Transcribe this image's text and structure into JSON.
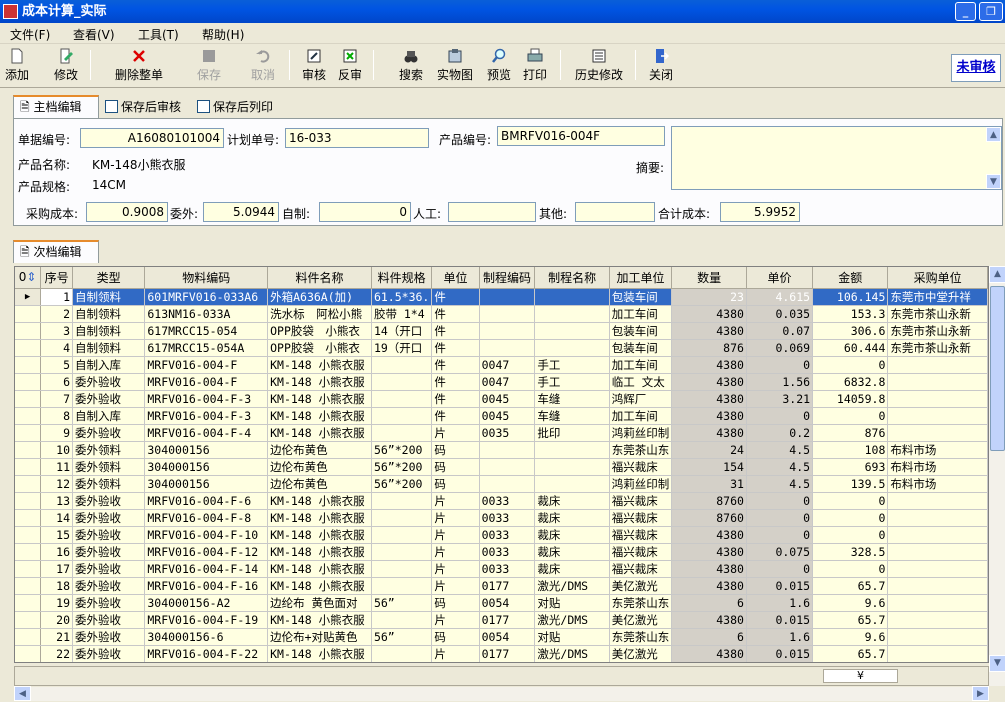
{
  "window": {
    "title": "成本计算_实际"
  },
  "menu": [
    "文件(F)",
    "查看(V)",
    "工具(T)",
    "帮助(H)"
  ],
  "toolbar": {
    "add": "添加",
    "edit": "修改",
    "delete_all": "删除整单",
    "save": "保存",
    "cancel": "取消",
    "review": "审核",
    "unreview": "反审",
    "search": "搜索",
    "photo": "实物图",
    "preview": "预览",
    "print": "打印",
    "history": "历史修改",
    "close": "关闭",
    "status": "未审核"
  },
  "main_tab": {
    "label": "主档编辑",
    "check_save_review": "保存后审核",
    "check_save_print": "保存后列印"
  },
  "form": {
    "doc_no_label": "单据编号:",
    "doc_no": "A16080101004",
    "plan_no_label": "计划单号:",
    "plan_no": "16-033",
    "product_no_label": "产品编号:",
    "product_no": "BMRFV016-004F",
    "product_name_label": "产品名称:",
    "product_name": "KM-148小熊衣服",
    "spec_label": "产品规格:",
    "spec": "14CM",
    "summary_label": "摘要:",
    "purchase_cost_label": "采购成本:",
    "purchase_cost": "0.9008",
    "outsource_label": "委外:",
    "outsource": "5.0944",
    "selfmade_label": "自制:",
    "selfmade": "0",
    "labor_label": "人工:",
    "labor": "",
    "other_label": "其他:",
    "other": "",
    "total_label": "合计成本:",
    "total": "5.9952"
  },
  "sub_tab": {
    "label": "次档编辑"
  },
  "grid": {
    "corner": "0",
    "headers": [
      "序号",
      "类型",
      "物料编码",
      "料件名称",
      "料件规格",
      "单位",
      "制程编码",
      "制程名称",
      "加工单位",
      "数量",
      "单价",
      "金额",
      "采购单位"
    ],
    "rows": [
      [
        "1",
        "自制领料",
        "601MRFV016-033A6",
        "外箱A636A(加)",
        "61.5*36.",
        "件",
        "",
        "",
        "包装车间",
        "23",
        "4.615",
        "106.145",
        "东莞市中堂升祥"
      ],
      [
        "2",
        "自制领料",
        "613NM16-033A",
        "洗水标　阿松小熊",
        "胶带 1*4",
        "件",
        "",
        "",
        "加工车间",
        "4380",
        "0.035",
        "153.3",
        "东莞市茶山永新"
      ],
      [
        "3",
        "自制领料",
        "617MRCC15-054",
        "OPP胶袋　小熊衣",
        "14（开口",
        "件",
        "",
        "",
        "包装车间",
        "4380",
        "0.07",
        "306.6",
        "东莞市茶山永新"
      ],
      [
        "4",
        "自制领料",
        "617MRCC15-054A",
        "OPP胶袋　小熊衣",
        "19（开口",
        "件",
        "",
        "",
        "包装车间",
        "876",
        "0.069",
        "60.444",
        "东莞市茶山永新"
      ],
      [
        "5",
        "自制入库",
        "MRFV016-004-F",
        "KM-148 小熊衣服",
        "",
        "件",
        "0047",
        "手工",
        "加工车间",
        "4380",
        "0",
        "0",
        ""
      ],
      [
        "6",
        "委外验收",
        "MRFV016-004-F",
        "KM-148 小熊衣服",
        "",
        "件",
        "0047",
        "手工",
        "临工 文太",
        "4380",
        "1.56",
        "6832.8",
        ""
      ],
      [
        "7",
        "委外验收",
        "MRFV016-004-F-3",
        "KM-148 小熊衣服",
        "",
        "件",
        "0045",
        "车缝",
        "鸿辉厂",
        "4380",
        "3.21",
        "14059.8",
        ""
      ],
      [
        "8",
        "自制入库",
        "MRFV016-004-F-3",
        "KM-148 小熊衣服",
        "",
        "件",
        "0045",
        "车缝",
        "加工车间",
        "4380",
        "0",
        "0",
        ""
      ],
      [
        "9",
        "委外验收",
        "MRFV016-004-F-4",
        "KM-148 小熊衣服",
        "",
        "片",
        "0035",
        "批印",
        "鸿莉丝印制",
        "4380",
        "0.2",
        "876",
        ""
      ],
      [
        "10",
        "委外领料",
        "304000156",
        "边伦布黄色",
        "56”*200",
        "码",
        "",
        "",
        "东莞茶山东",
        "24",
        "4.5",
        "108",
        "布料市场"
      ],
      [
        "11",
        "委外领料",
        "304000156",
        "边伦布黄色",
        "56”*200",
        "码",
        "",
        "",
        "福兴裁床",
        "154",
        "4.5",
        "693",
        "布料市场"
      ],
      [
        "12",
        "委外领料",
        "304000156",
        "边伦布黄色",
        "56”*200",
        "码",
        "",
        "",
        "鸿莉丝印制",
        "31",
        "4.5",
        "139.5",
        "布料市场"
      ],
      [
        "13",
        "委外验收",
        "MRFV016-004-F-6",
        "KM-148 小熊衣服",
        "",
        "片",
        "0033",
        "裁床",
        "福兴裁床",
        "8760",
        "0",
        "0",
        ""
      ],
      [
        "14",
        "委外验收",
        "MRFV016-004-F-8",
        "KM-148 小熊衣服",
        "",
        "片",
        "0033",
        "裁床",
        "福兴裁床",
        "8760",
        "0",
        "0",
        ""
      ],
      [
        "15",
        "委外验收",
        "MRFV016-004-F-10",
        "KM-148 小熊衣服",
        "",
        "片",
        "0033",
        "裁床",
        "福兴裁床",
        "4380",
        "0",
        "0",
        ""
      ],
      [
        "16",
        "委外验收",
        "MRFV016-004-F-12",
        "KM-148 小熊衣服",
        "",
        "片",
        "0033",
        "裁床",
        "福兴裁床",
        "4380",
        "0.075",
        "328.5",
        ""
      ],
      [
        "17",
        "委外验收",
        "MRFV016-004-F-14",
        "KM-148 小熊衣服",
        "",
        "片",
        "0033",
        "裁床",
        "福兴裁床",
        "4380",
        "0",
        "0",
        ""
      ],
      [
        "18",
        "委外验收",
        "MRFV016-004-F-16",
        "KM-148 小熊衣服",
        "",
        "片",
        "0177",
        "激光/DMS",
        "美亿激光",
        "4380",
        "0.015",
        "65.7",
        ""
      ],
      [
        "19",
        "委外验收",
        "304000156-A2",
        "边纶布 黄色面对",
        "56”",
        "码",
        "0054",
        "对贴",
        "东莞茶山东",
        "6",
        "1.6",
        "9.6",
        ""
      ],
      [
        "20",
        "委外验收",
        "MRFV016-004-F-19",
        "KM-148 小熊衣服",
        "",
        "片",
        "0177",
        "激光/DMS",
        "美亿激光",
        "4380",
        "0.015",
        "65.7",
        ""
      ],
      [
        "21",
        "委外验收",
        "304000156-6",
        "边伦布+对贴黄色",
        "56”",
        "码",
        "0054",
        "对贴",
        "东莞茶山东",
        "6",
        "1.6",
        "9.6",
        ""
      ],
      [
        "22",
        "委外验收",
        "MRFV016-004-F-22",
        "KM-148 小熊衣服",
        "",
        "片",
        "0177",
        "激光/DMS",
        "美亿激光",
        "4380",
        "0.015",
        "65.7",
        ""
      ]
    ],
    "footer_symbol": "¥"
  }
}
